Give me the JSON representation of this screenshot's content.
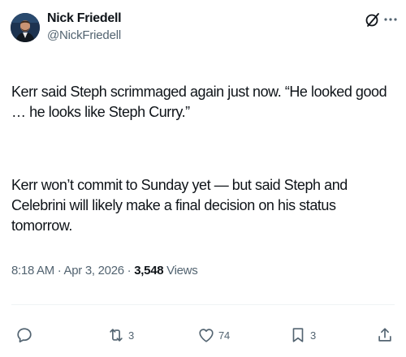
{
  "author": {
    "name": "Nick Friedell",
    "handle": "@NickFriedell"
  },
  "tweet": {
    "paragraph1": "Kerr said Steph scrimmaged again just now. “He looked good … he looks like Steph Curry.”",
    "paragraph2": "Kerr won’t commit to Sunday yet — but said Steph and Celebrini will likely make a final decision on his status tomorrow."
  },
  "meta": {
    "time": "8:18 AM",
    "separator1": " · ",
    "date": "Apr 3, 2026",
    "separator2": " · ",
    "views_count": "3,548",
    "views_label": " Views"
  },
  "actions": {
    "reply_count": "",
    "retweet_count": "3",
    "like_count": "74",
    "bookmark_count": "3"
  },
  "icons": {
    "grok": "grok-icon",
    "more": "more-icon",
    "reply": "reply-icon",
    "retweet": "retweet-icon",
    "like": "heart-icon",
    "bookmark": "bookmark-icon",
    "share": "share-icon"
  },
  "colors": {
    "text": "#0f1419",
    "secondary": "#536471",
    "divider": "#eff3f4",
    "background": "#ffffff"
  }
}
